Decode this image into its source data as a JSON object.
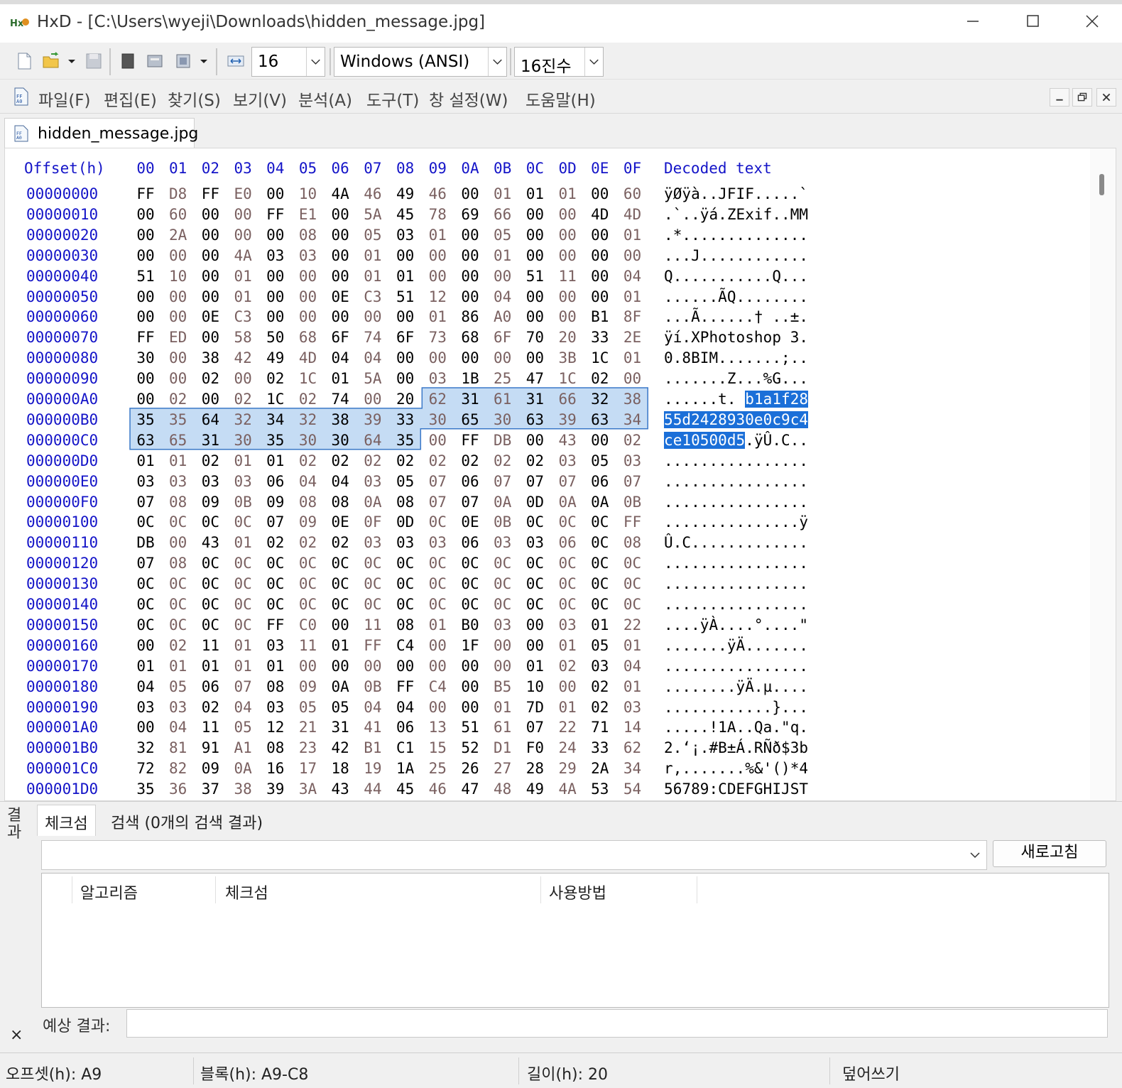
{
  "window": {
    "title": "HxD - [C:\\Users\\wyeji\\Downloads\\hidden_message.jpg]"
  },
  "toolbar": {
    "bytes_per_row": "16",
    "charset": "Windows (ANSI)",
    "offset_base": "16진수"
  },
  "menu": [
    "파일(F)",
    "편집(E)",
    "찾기(S)",
    "보기(V)",
    "분석(A)",
    "도구(T)",
    "창 설정(W)",
    "도움말(H)"
  ],
  "document_tab": "hidden_message.jpg",
  "hex": {
    "offset_header": "Offset(h)",
    "column_headers": [
      "00",
      "01",
      "02",
      "03",
      "04",
      "05",
      "06",
      "07",
      "08",
      "09",
      "0A",
      "0B",
      "0C",
      "0D",
      "0E",
      "0F"
    ],
    "decoded_header": "Decoded text",
    "selection_start": 169,
    "selection_length": 32,
    "rows": [
      {
        "offset": "00000000",
        "bytes": [
          "FF",
          "D8",
          "FF",
          "E0",
          "00",
          "10",
          "4A",
          "46",
          "49",
          "46",
          "00",
          "01",
          "01",
          "01",
          "00",
          "60"
        ],
        "text": "ÿØÿà..JFIF.....`"
      },
      {
        "offset": "00000010",
        "bytes": [
          "00",
          "60",
          "00",
          "00",
          "FF",
          "E1",
          "00",
          "5A",
          "45",
          "78",
          "69",
          "66",
          "00",
          "00",
          "4D",
          "4D"
        ],
        "text": ".`..ÿá.ZExif..MM"
      },
      {
        "offset": "00000020",
        "bytes": [
          "00",
          "2A",
          "00",
          "00",
          "00",
          "08",
          "00",
          "05",
          "03",
          "01",
          "00",
          "05",
          "00",
          "00",
          "00",
          "01"
        ],
        "text": ".*.............."
      },
      {
        "offset": "00000030",
        "bytes": [
          "00",
          "00",
          "00",
          "4A",
          "03",
          "03",
          "00",
          "01",
          "00",
          "00",
          "00",
          "01",
          "00",
          "00",
          "00",
          "00"
        ],
        "text": "...J............"
      },
      {
        "offset": "00000040",
        "bytes": [
          "51",
          "10",
          "00",
          "01",
          "00",
          "00",
          "00",
          "01",
          "01",
          "00",
          "00",
          "00",
          "51",
          "11",
          "00",
          "04"
        ],
        "text": "Q...........Q..."
      },
      {
        "offset": "00000050",
        "bytes": [
          "00",
          "00",
          "00",
          "01",
          "00",
          "00",
          "0E",
          "C3",
          "51",
          "12",
          "00",
          "04",
          "00",
          "00",
          "00",
          "01"
        ],
        "text": "......ÃQ........"
      },
      {
        "offset": "00000060",
        "bytes": [
          "00",
          "00",
          "0E",
          "C3",
          "00",
          "00",
          "00",
          "00",
          "00",
          "01",
          "86",
          "A0",
          "00",
          "00",
          "B1",
          "8F"
        ],
        "text": "...Ã......† ..±."
      },
      {
        "offset": "00000070",
        "bytes": [
          "FF",
          "ED",
          "00",
          "58",
          "50",
          "68",
          "6F",
          "74",
          "6F",
          "73",
          "68",
          "6F",
          "70",
          "20",
          "33",
          "2E"
        ],
        "text": "ÿí.XPhotoshop 3."
      },
      {
        "offset": "00000080",
        "bytes": [
          "30",
          "00",
          "38",
          "42",
          "49",
          "4D",
          "04",
          "04",
          "00",
          "00",
          "00",
          "00",
          "00",
          "3B",
          "1C",
          "01"
        ],
        "text": "0.8BIM.......;.."
      },
      {
        "offset": "00000090",
        "bytes": [
          "00",
          "00",
          "02",
          "00",
          "02",
          "1C",
          "01",
          "5A",
          "00",
          "03",
          "1B",
          "25",
          "47",
          "1C",
          "02",
          "00"
        ],
        "text": ".......Z...%G..."
      },
      {
        "offset": "000000A0",
        "bytes": [
          "00",
          "02",
          "00",
          "02",
          "1C",
          "02",
          "74",
          "00",
          "20",
          "62",
          "31",
          "61",
          "31",
          "66",
          "32",
          "38"
        ],
        "text": "......t. b1a1f28"
      },
      {
        "offset": "000000B0",
        "bytes": [
          "35",
          "35",
          "64",
          "32",
          "34",
          "32",
          "38",
          "39",
          "33",
          "30",
          "65",
          "30",
          "63",
          "39",
          "63",
          "34"
        ],
        "text": "55d2428930e0c9c4"
      },
      {
        "offset": "000000C0",
        "bytes": [
          "63",
          "65",
          "31",
          "30",
          "35",
          "30",
          "30",
          "64",
          "35",
          "00",
          "FF",
          "DB",
          "00",
          "43",
          "00",
          "02"
        ],
        "text": "ce10500d5.ÿÛ.C.."
      },
      {
        "offset": "000000D0",
        "bytes": [
          "01",
          "01",
          "02",
          "01",
          "01",
          "02",
          "02",
          "02",
          "02",
          "02",
          "02",
          "02",
          "02",
          "03",
          "05",
          "03"
        ],
        "text": "................"
      },
      {
        "offset": "000000E0",
        "bytes": [
          "03",
          "03",
          "03",
          "03",
          "06",
          "04",
          "04",
          "03",
          "05",
          "07",
          "06",
          "07",
          "07",
          "07",
          "06",
          "07"
        ],
        "text": "................"
      },
      {
        "offset": "000000F0",
        "bytes": [
          "07",
          "08",
          "09",
          "0B",
          "09",
          "08",
          "08",
          "0A",
          "08",
          "07",
          "07",
          "0A",
          "0D",
          "0A",
          "0A",
          "0B"
        ],
        "text": "................"
      },
      {
        "offset": "00000100",
        "bytes": [
          "0C",
          "0C",
          "0C",
          "0C",
          "07",
          "09",
          "0E",
          "0F",
          "0D",
          "0C",
          "0E",
          "0B",
          "0C",
          "0C",
          "0C",
          "FF"
        ],
        "text": "...............ÿ"
      },
      {
        "offset": "00000110",
        "bytes": [
          "DB",
          "00",
          "43",
          "01",
          "02",
          "02",
          "02",
          "03",
          "03",
          "03",
          "06",
          "03",
          "03",
          "06",
          "0C",
          "08"
        ],
        "text": "Û.C............."
      },
      {
        "offset": "00000120",
        "bytes": [
          "07",
          "08",
          "0C",
          "0C",
          "0C",
          "0C",
          "0C",
          "0C",
          "0C",
          "0C",
          "0C",
          "0C",
          "0C",
          "0C",
          "0C",
          "0C"
        ],
        "text": "................"
      },
      {
        "offset": "00000130",
        "bytes": [
          "0C",
          "0C",
          "0C",
          "0C",
          "0C",
          "0C",
          "0C",
          "0C",
          "0C",
          "0C",
          "0C",
          "0C",
          "0C",
          "0C",
          "0C",
          "0C"
        ],
        "text": "................"
      },
      {
        "offset": "00000140",
        "bytes": [
          "0C",
          "0C",
          "0C",
          "0C",
          "0C",
          "0C",
          "0C",
          "0C",
          "0C",
          "0C",
          "0C",
          "0C",
          "0C",
          "0C",
          "0C",
          "0C"
        ],
        "text": "................"
      },
      {
        "offset": "00000150",
        "bytes": [
          "0C",
          "0C",
          "0C",
          "0C",
          "FF",
          "C0",
          "00",
          "11",
          "08",
          "01",
          "B0",
          "03",
          "00",
          "03",
          "01",
          "22"
        ],
        "text": "....ÿÀ....°....\""
      },
      {
        "offset": "00000160",
        "bytes": [
          "00",
          "02",
          "11",
          "01",
          "03",
          "11",
          "01",
          "FF",
          "C4",
          "00",
          "1F",
          "00",
          "00",
          "01",
          "05",
          "01"
        ],
        "text": ".......ÿÄ......."
      },
      {
        "offset": "00000170",
        "bytes": [
          "01",
          "01",
          "01",
          "01",
          "01",
          "00",
          "00",
          "00",
          "00",
          "00",
          "00",
          "00",
          "01",
          "02",
          "03",
          "04"
        ],
        "text": "................"
      },
      {
        "offset": "00000180",
        "bytes": [
          "04",
          "05",
          "06",
          "07",
          "08",
          "09",
          "0A",
          "0B",
          "FF",
          "C4",
          "00",
          "B5",
          "10",
          "00",
          "02",
          "01"
        ],
        "text": "........ÿÄ.µ...."
      },
      {
        "offset": "00000190",
        "bytes": [
          "03",
          "03",
          "02",
          "04",
          "03",
          "05",
          "05",
          "04",
          "04",
          "00",
          "00",
          "01",
          "7D",
          "01",
          "02",
          "03"
        ],
        "text": "............}..."
      },
      {
        "offset": "000001A0",
        "bytes": [
          "00",
          "04",
          "11",
          "05",
          "12",
          "21",
          "31",
          "41",
          "06",
          "13",
          "51",
          "61",
          "07",
          "22",
          "71",
          "14"
        ],
        "text": ".....!1A..Qa.\"q."
      },
      {
        "offset": "000001B0",
        "bytes": [
          "32",
          "81",
          "91",
          "A1",
          "08",
          "23",
          "42",
          "B1",
          "C1",
          "15",
          "52",
          "D1",
          "F0",
          "24",
          "33",
          "62"
        ],
        "text": "2.‘¡.#B±Á.RÑð$3b"
      },
      {
        "offset": "000001C0",
        "bytes": [
          "72",
          "82",
          "09",
          "0A",
          "16",
          "17",
          "18",
          "19",
          "1A",
          "25",
          "26",
          "27",
          "28",
          "29",
          "2A",
          "34"
        ],
        "text": "r‚.......%&'()*4"
      },
      {
        "offset": "000001D0",
        "bytes": [
          "35",
          "36",
          "37",
          "38",
          "39",
          "3A",
          "43",
          "44",
          "45",
          "46",
          "47",
          "48",
          "49",
          "4A",
          "53",
          "54"
        ],
        "text": "56789:CDEFGHIJST"
      }
    ]
  },
  "results_panel": {
    "vertical_label": "결과",
    "tabs": [
      "체크섬",
      "검색 (0개의 검색 결과)"
    ],
    "refresh_button": "새로고침",
    "columns": [
      "알고리즘",
      "체크섬",
      "사용방법"
    ],
    "expected_label": "예상 결과:",
    "close_glyph": "×"
  },
  "status": {
    "offset": "오프셋(h): A9",
    "block": "블록(h): A9-C8",
    "length": "길이(h): 20",
    "mode": "덮어쓰기"
  },
  "colors": {
    "offset_blue": "#1414c8",
    "selection_fill": "#c5dcf4",
    "selection_border": "#3a78c8",
    "text_selection": "#1b6fd8"
  }
}
